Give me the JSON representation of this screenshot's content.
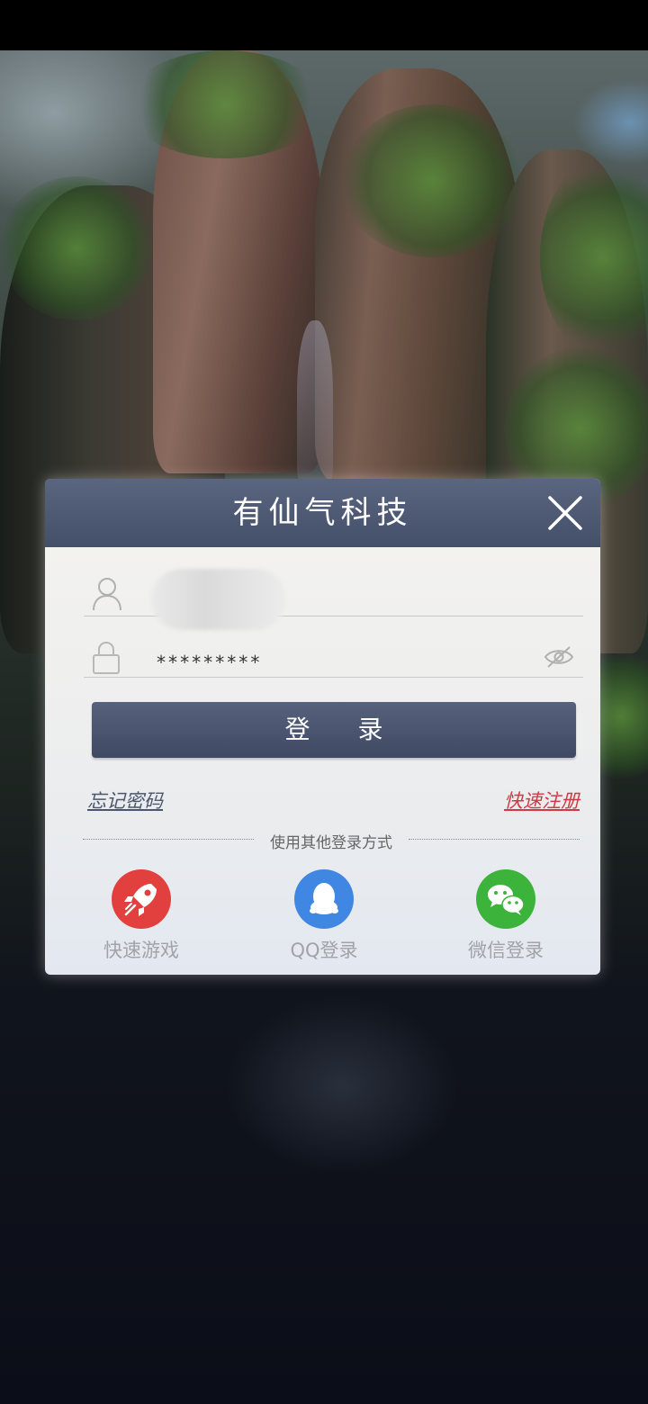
{
  "dialog": {
    "title": "有仙气科技",
    "password_value": "*********",
    "login_label": "登 录",
    "forgot_password": "忘记密码",
    "quick_register": "快速注册",
    "other_methods_label": "使用其他登录方式",
    "alt_logins": [
      {
        "label": "快速游戏",
        "icon": "rocket-icon",
        "color": "#e2403f"
      },
      {
        "label": "QQ登录",
        "icon": "qq-penguin-icon",
        "color": "#3f87e2"
      },
      {
        "label": "微信登录",
        "icon": "wechat-icon",
        "color": "#3cb33a"
      }
    ]
  },
  "colors": {
    "header": "#4a556f",
    "register_link": "#d03a46",
    "forgot_link": "#4c566e"
  }
}
